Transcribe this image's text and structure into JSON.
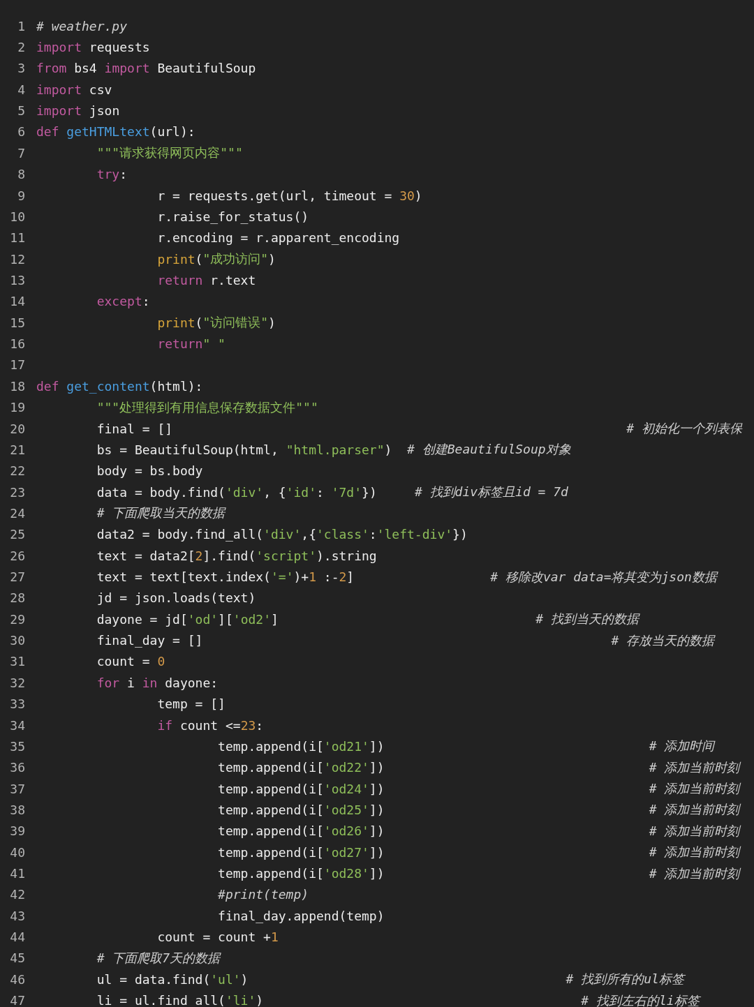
{
  "editor": {
    "lines": [
      {
        "number": "1",
        "tokens": [
          {
            "kind": "comment",
            "text": "# weather.py"
          }
        ]
      },
      {
        "number": "2",
        "tokens": [
          {
            "kind": "keyword",
            "text": "import"
          },
          {
            "kind": "plain",
            "text": " requests"
          }
        ]
      },
      {
        "number": "3",
        "tokens": [
          {
            "kind": "keyword",
            "text": "from"
          },
          {
            "kind": "plain",
            "text": " bs4 "
          },
          {
            "kind": "keyword",
            "text": "import"
          },
          {
            "kind": "plain",
            "text": " BeautifulSoup"
          }
        ]
      },
      {
        "number": "4",
        "tokens": [
          {
            "kind": "keyword",
            "text": "import"
          },
          {
            "kind": "plain",
            "text": " csv"
          }
        ]
      },
      {
        "number": "5",
        "tokens": [
          {
            "kind": "keyword",
            "text": "import"
          },
          {
            "kind": "plain",
            "text": " json"
          }
        ]
      },
      {
        "number": "6",
        "tokens": [
          {
            "kind": "keyword",
            "text": "def"
          },
          {
            "kind": "function",
            "text": " getHTMLtext"
          },
          {
            "kind": "plain",
            "text": "(url):"
          }
        ]
      },
      {
        "number": "7",
        "tokens": [
          {
            "kind": "string",
            "text": "        \"\"\"请求获得网页内容\"\"\""
          }
        ]
      },
      {
        "number": "8",
        "tokens": [
          {
            "kind": "keyword",
            "text": "        try"
          },
          {
            "kind": "plain",
            "text": ":"
          }
        ]
      },
      {
        "number": "9",
        "tokens": [
          {
            "kind": "plain",
            "text": "                r = requests.get(url, timeout = "
          },
          {
            "kind": "number",
            "text": "30"
          },
          {
            "kind": "plain",
            "text": ")"
          }
        ]
      },
      {
        "number": "10",
        "tokens": [
          {
            "kind": "plain",
            "text": "                r.raise_for_status()"
          }
        ]
      },
      {
        "number": "11",
        "tokens": [
          {
            "kind": "plain",
            "text": "                r.encoding = r.apparent_encoding"
          }
        ]
      },
      {
        "number": "12",
        "tokens": [
          {
            "kind": "builtin",
            "text": "                print"
          },
          {
            "kind": "plain",
            "text": "("
          },
          {
            "kind": "string",
            "text": "\"成功访问\""
          },
          {
            "kind": "plain",
            "text": ")"
          }
        ]
      },
      {
        "number": "13",
        "tokens": [
          {
            "kind": "keyword",
            "text": "                return"
          },
          {
            "kind": "plain",
            "text": " r.text"
          }
        ]
      },
      {
        "number": "14",
        "tokens": [
          {
            "kind": "keyword",
            "text": "        except"
          },
          {
            "kind": "plain",
            "text": ":"
          }
        ]
      },
      {
        "number": "15",
        "tokens": [
          {
            "kind": "builtin",
            "text": "                print"
          },
          {
            "kind": "plain",
            "text": "("
          },
          {
            "kind": "string",
            "text": "\"访问错误\""
          },
          {
            "kind": "plain",
            "text": ")"
          }
        ]
      },
      {
        "number": "16",
        "tokens": [
          {
            "kind": "keyword",
            "text": "                return"
          },
          {
            "kind": "string",
            "text": "\" \""
          }
        ]
      },
      {
        "number": "17"
      },
      {
        "number": "18",
        "tokens": [
          {
            "kind": "keyword",
            "text": "def"
          },
          {
            "kind": "function",
            "text": " get_content"
          },
          {
            "kind": "plain",
            "text": "(html):"
          }
        ]
      },
      {
        "number": "19",
        "tokens": [
          {
            "kind": "string",
            "text": "        \"\"\"处理得到有用信息保存数据文件\"\"\""
          }
        ]
      },
      {
        "number": "20",
        "tokens": [
          {
            "kind": "plain",
            "text": "        final = []                                                            "
          },
          {
            "kind": "comment",
            "text": "# 初始化一个列表保"
          }
        ]
      },
      {
        "number": "21",
        "tokens": [
          {
            "kind": "plain",
            "text": "        bs = BeautifulSoup(html, "
          },
          {
            "kind": "string",
            "text": "\"html.parser\""
          },
          {
            "kind": "plain",
            "text": ")  "
          },
          {
            "kind": "comment",
            "text": "# 创建BeautifulSoup对象"
          }
        ]
      },
      {
        "number": "22",
        "tokens": [
          {
            "kind": "plain",
            "text": "        body = bs.body"
          }
        ]
      },
      {
        "number": "23",
        "tokens": [
          {
            "kind": "plain",
            "text": "        data = body.find("
          },
          {
            "kind": "string",
            "text": "'div'"
          },
          {
            "kind": "plain",
            "text": ", {"
          },
          {
            "kind": "string",
            "text": "'id'"
          },
          {
            "kind": "plain",
            "text": ": "
          },
          {
            "kind": "string",
            "text": "'7d'"
          },
          {
            "kind": "plain",
            "text": "})     "
          },
          {
            "kind": "comment",
            "text": "# 找到div标签且id = 7d"
          }
        ]
      },
      {
        "number": "24",
        "tokens": [
          {
            "kind": "comment",
            "text": "        # 下面爬取当天的数据"
          }
        ]
      },
      {
        "number": "25",
        "tokens": [
          {
            "kind": "plain",
            "text": "        data2 = body.find_all("
          },
          {
            "kind": "string",
            "text": "'div'"
          },
          {
            "kind": "plain",
            "text": ",{"
          },
          {
            "kind": "string",
            "text": "'class'"
          },
          {
            "kind": "plain",
            "text": ":"
          },
          {
            "kind": "string",
            "text": "'left-div'"
          },
          {
            "kind": "plain",
            "text": "})"
          }
        ]
      },
      {
        "number": "26",
        "tokens": [
          {
            "kind": "plain",
            "text": "        text = data2["
          },
          {
            "kind": "number",
            "text": "2"
          },
          {
            "kind": "plain",
            "text": "].find("
          },
          {
            "kind": "string",
            "text": "'script'"
          },
          {
            "kind": "plain",
            "text": ").string"
          }
        ]
      },
      {
        "number": "27",
        "tokens": [
          {
            "kind": "plain",
            "text": "        text = text[text.index("
          },
          {
            "kind": "string",
            "text": "'='"
          },
          {
            "kind": "plain",
            "text": ")+"
          },
          {
            "kind": "number",
            "text": "1"
          },
          {
            "kind": "plain",
            "text": " :-"
          },
          {
            "kind": "number",
            "text": "2"
          },
          {
            "kind": "plain",
            "text": "]                  "
          },
          {
            "kind": "comment",
            "text": "# 移除改var data=将其变为json数据"
          }
        ]
      },
      {
        "number": "28",
        "tokens": [
          {
            "kind": "plain",
            "text": "        jd = json.loads(text)"
          }
        ]
      },
      {
        "number": "29",
        "tokens": [
          {
            "kind": "plain",
            "text": "        dayone = jd["
          },
          {
            "kind": "string",
            "text": "'od'"
          },
          {
            "kind": "plain",
            "text": "]["
          },
          {
            "kind": "string",
            "text": "'od2'"
          },
          {
            "kind": "plain",
            "text": "]                                  "
          },
          {
            "kind": "comment",
            "text": "# 找到当天的数据"
          }
        ]
      },
      {
        "number": "30",
        "tokens": [
          {
            "kind": "plain",
            "text": "        final_day = []                                                      "
          },
          {
            "kind": "comment",
            "text": "# 存放当天的数据"
          }
        ]
      },
      {
        "number": "31",
        "tokens": [
          {
            "kind": "plain",
            "text": "        count = "
          },
          {
            "kind": "number",
            "text": "0"
          }
        ]
      },
      {
        "number": "32",
        "tokens": [
          {
            "kind": "keyword",
            "text": "        for"
          },
          {
            "kind": "plain",
            "text": " i "
          },
          {
            "kind": "keyword",
            "text": "in"
          },
          {
            "kind": "plain",
            "text": " dayone:"
          }
        ]
      },
      {
        "number": "33",
        "tokens": [
          {
            "kind": "plain",
            "text": "                temp = []"
          }
        ]
      },
      {
        "number": "34",
        "tokens": [
          {
            "kind": "keyword",
            "text": "                if"
          },
          {
            "kind": "plain",
            "text": " count <="
          },
          {
            "kind": "number",
            "text": "23"
          },
          {
            "kind": "plain",
            "text": ":"
          }
        ]
      },
      {
        "number": "35",
        "tokens": [
          {
            "kind": "plain",
            "text": "                        temp.append(i["
          },
          {
            "kind": "string",
            "text": "'od21'"
          },
          {
            "kind": "plain",
            "text": "])                                   "
          },
          {
            "kind": "comment",
            "text": "# 添加时间"
          }
        ]
      },
      {
        "number": "36",
        "tokens": [
          {
            "kind": "plain",
            "text": "                        temp.append(i["
          },
          {
            "kind": "string",
            "text": "'od22'"
          },
          {
            "kind": "plain",
            "text": "])                                   "
          },
          {
            "kind": "comment",
            "text": "# 添加当前时刻"
          }
        ]
      },
      {
        "number": "37",
        "tokens": [
          {
            "kind": "plain",
            "text": "                        temp.append(i["
          },
          {
            "kind": "string",
            "text": "'od24'"
          },
          {
            "kind": "plain",
            "text": "])                                   "
          },
          {
            "kind": "comment",
            "text": "# 添加当前时刻"
          }
        ]
      },
      {
        "number": "38",
        "tokens": [
          {
            "kind": "plain",
            "text": "                        temp.append(i["
          },
          {
            "kind": "string",
            "text": "'od25'"
          },
          {
            "kind": "plain",
            "text": "])                                   "
          },
          {
            "kind": "comment",
            "text": "# 添加当前时刻"
          }
        ]
      },
      {
        "number": "39",
        "tokens": [
          {
            "kind": "plain",
            "text": "                        temp.append(i["
          },
          {
            "kind": "string",
            "text": "'od26'"
          },
          {
            "kind": "plain",
            "text": "])                                   "
          },
          {
            "kind": "comment",
            "text": "# 添加当前时刻"
          }
        ]
      },
      {
        "number": "40",
        "tokens": [
          {
            "kind": "plain",
            "text": "                        temp.append(i["
          },
          {
            "kind": "string",
            "text": "'od27'"
          },
          {
            "kind": "plain",
            "text": "])                                   "
          },
          {
            "kind": "comment",
            "text": "# 添加当前时刻"
          }
        ]
      },
      {
        "number": "41",
        "tokens": [
          {
            "kind": "plain",
            "text": "                        temp.append(i["
          },
          {
            "kind": "string",
            "text": "'od28'"
          },
          {
            "kind": "plain",
            "text": "])                                   "
          },
          {
            "kind": "comment",
            "text": "# 添加当前时刻"
          }
        ]
      },
      {
        "number": "42",
        "tokens": [
          {
            "kind": "comment",
            "text": "                        #print(temp)"
          }
        ]
      },
      {
        "number": "43",
        "tokens": [
          {
            "kind": "plain",
            "text": "                        final_day.append(temp)"
          }
        ]
      },
      {
        "number": "44",
        "tokens": [
          {
            "kind": "plain",
            "text": "                count = count +"
          },
          {
            "kind": "number",
            "text": "1"
          }
        ]
      },
      {
        "number": "45",
        "tokens": [
          {
            "kind": "comment",
            "text": "        # 下面爬取7天的数据"
          }
        ]
      },
      {
        "number": "46",
        "tokens": [
          {
            "kind": "plain",
            "text": "        ul = data.find("
          },
          {
            "kind": "string",
            "text": "'ul'"
          },
          {
            "kind": "plain",
            "text": ")                                          "
          },
          {
            "kind": "comment",
            "text": "# 找到所有的ul标签"
          }
        ]
      },
      {
        "number": "47",
        "tokens": [
          {
            "kind": "plain",
            "text": "        li = ul.find_all("
          },
          {
            "kind": "string",
            "text": "'li'"
          },
          {
            "kind": "plain",
            "text": ")                                          "
          },
          {
            "kind": "comment",
            "text": "# 找到左右的li标签"
          }
        ]
      }
    ]
  }
}
